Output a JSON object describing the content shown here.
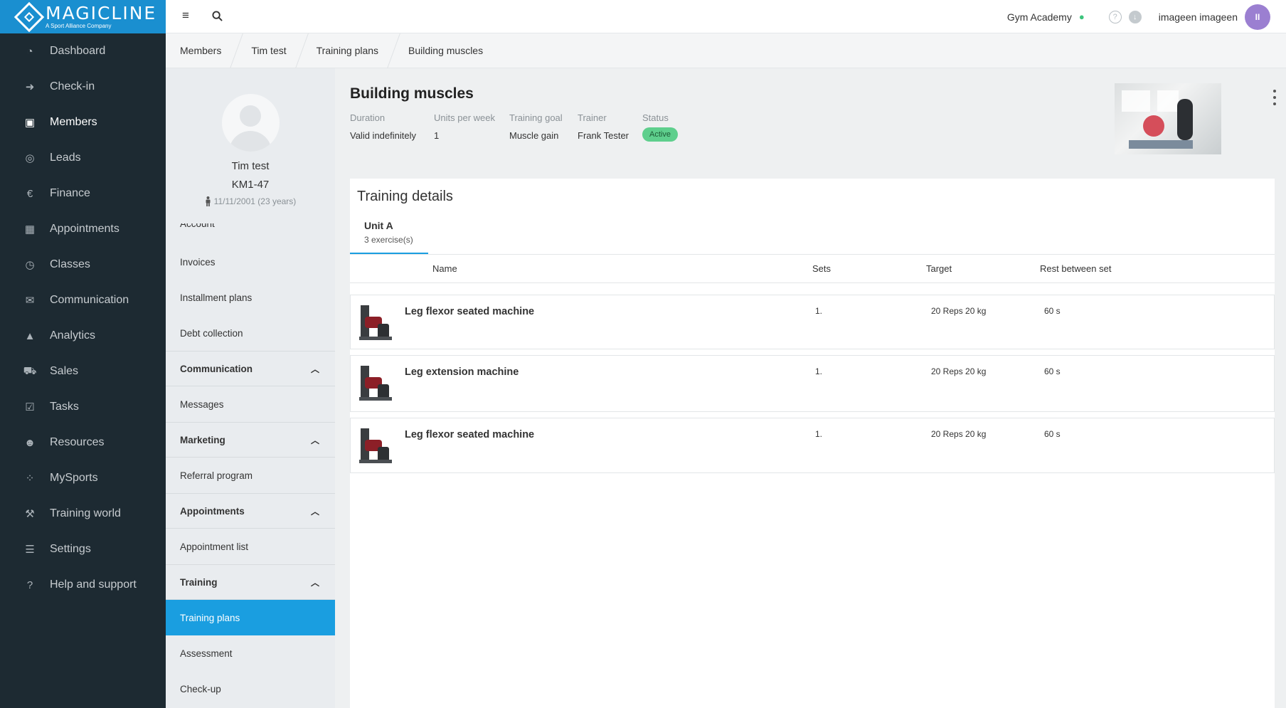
{
  "brand": {
    "name": "MAGICLINE",
    "tagline": "A Sport Alliance Company"
  },
  "sidebar": {
    "items": [
      {
        "label": "Dashboard",
        "icon": "dashboard-icon"
      },
      {
        "label": "Check-in",
        "icon": "check-in-icon"
      },
      {
        "label": "Members",
        "icon": "members-icon",
        "active": true
      },
      {
        "label": "Leads",
        "icon": "leads-icon"
      },
      {
        "label": "Finance",
        "icon": "finance-icon"
      },
      {
        "label": "Appointments",
        "icon": "calendar-icon"
      },
      {
        "label": "Classes",
        "icon": "stopwatch-icon"
      },
      {
        "label": "Communication",
        "icon": "chat-icon"
      },
      {
        "label": "Analytics",
        "icon": "chart-icon"
      },
      {
        "label": "Sales",
        "icon": "cart-icon"
      },
      {
        "label": "Tasks",
        "icon": "checkbox-icon"
      },
      {
        "label": "Resources",
        "icon": "people-icon"
      },
      {
        "label": "MySports",
        "icon": "grid-dots-icon"
      },
      {
        "label": "Training world",
        "icon": "dumbbell-icon"
      },
      {
        "label": "Settings",
        "icon": "sliders-icon"
      },
      {
        "label": "Help and support",
        "icon": "help-icon"
      }
    ]
  },
  "topbar": {
    "studio": "Gym Academy",
    "user": "imageen imageen",
    "avatar_initials": "II"
  },
  "breadcrumb": [
    "Members",
    "Tim test",
    "Training plans",
    "Building muscles"
  ],
  "member": {
    "name": "Tim test",
    "id": "KM1-47",
    "dob": "11/11/2001 (23 years)"
  },
  "member_nav": {
    "account": "Account",
    "invoices": "Invoices",
    "installment_plans": "Installment plans",
    "debt_collection": "Debt collection",
    "communication_head": "Communication",
    "messages": "Messages",
    "marketing_head": "Marketing",
    "referral_program": "Referral program",
    "appointments_head": "Appointments",
    "appointment_list": "Appointment list",
    "training_head": "Training",
    "training_plans": "Training plans",
    "assessment": "Assessment",
    "check_up": "Check-up"
  },
  "plan": {
    "title": "Building muscles",
    "duration_label": "Duration",
    "duration": "Valid indefinitely",
    "units_label": "Units per week",
    "units": "1",
    "goal_label": "Training goal",
    "goal": "Muscle gain",
    "trainer_label": "Trainer",
    "trainer": "Frank Tester",
    "status_label": "Status",
    "status": "Active"
  },
  "details": {
    "title": "Training details",
    "unit": {
      "label": "Unit A",
      "count": "3 exercise(s)"
    },
    "columns": {
      "name": "Name",
      "sets": "Sets",
      "target": "Target",
      "rest": "Rest between set"
    },
    "exercises": [
      {
        "name": "Leg flexor seated machine",
        "sets": "1.",
        "target": "20 Reps  20 kg",
        "rest": "60 s"
      },
      {
        "name": "Leg extension machine",
        "sets": "1.",
        "target": "20 Reps  20 kg",
        "rest": "60 s"
      },
      {
        "name": "Leg flexor seated machine",
        "sets": "1.",
        "target": "20 Reps  20 kg",
        "rest": "60 s"
      }
    ]
  },
  "colors": {
    "brand_blue": "#1a8fd0",
    "sidebar_bg": "#1d2a32",
    "active_item": "#1a9ee0",
    "status_active": "#5ecf8d",
    "avatar": "#9b7fd1"
  }
}
